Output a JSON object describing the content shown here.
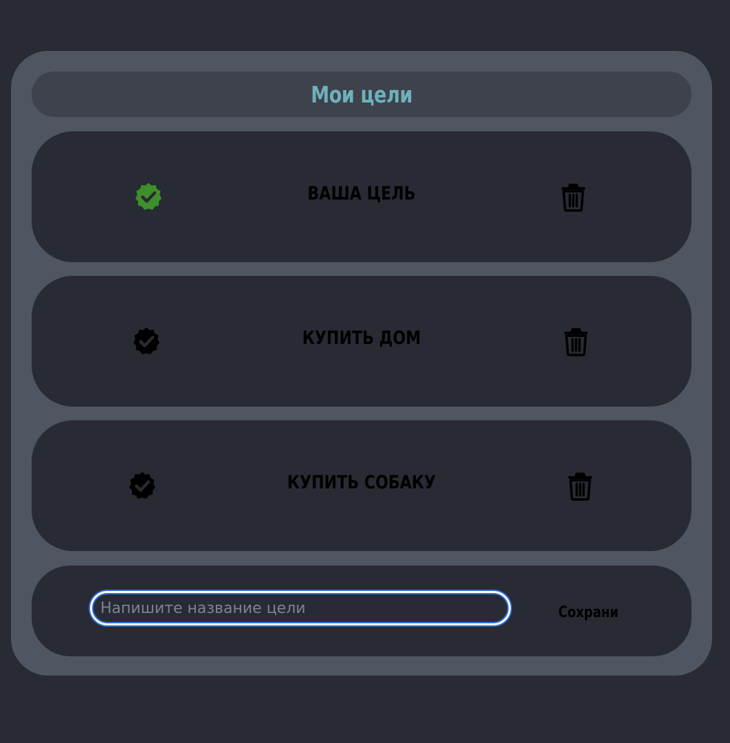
{
  "header": {
    "title": "Мои цели"
  },
  "goals": [
    {
      "title": "ВАША ЦЕЛЬ",
      "completed": true,
      "check_icon": "check-badge-icon",
      "delete_icon": "trash-icon"
    },
    {
      "title": "КУПИТЬ ДОМ",
      "completed": false,
      "check_icon": "check-badge-icon",
      "delete_icon": "trash-icon"
    },
    {
      "title": "КУПИТЬ СОБАКУ",
      "completed": false,
      "check_icon": "check-badge-icon",
      "delete_icon": "trash-icon"
    }
  ],
  "add_form": {
    "input_value": "",
    "input_placeholder": "Напишите название цели",
    "save_label": "Сохрани"
  },
  "colors": {
    "background": "#282b33",
    "panel": "#4f5561",
    "header_bg": "#3e424d",
    "title_accent": "#6fb0bb",
    "completed_check": "#3f8f2a",
    "pending_check": "#000000",
    "input_focus_ring": "#2f6fd6"
  }
}
